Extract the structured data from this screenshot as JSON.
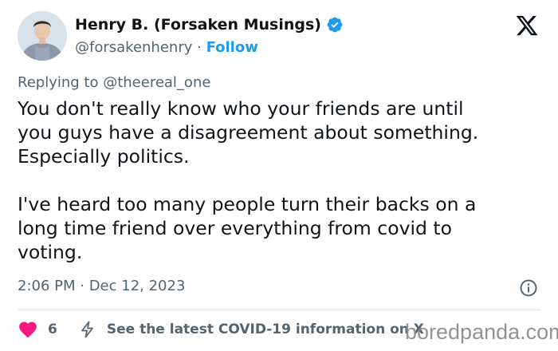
{
  "author": {
    "display_name": "Henry B. (Forsaken Musings)",
    "handle": "@forsakenhenry",
    "separator": "·",
    "follow_label": "Follow",
    "verified_color": "#1d9bf0"
  },
  "reply": {
    "prefix": "Replying to ",
    "mention": "@theereal_one"
  },
  "tweet": {
    "text": "You don't really know who your friends are until\nyou guys have a disagreement about something.\nEspecially politics.\n\nI've heard too many people turn their backs on a\nlong time friend over everything from covid to\nvoting.",
    "timestamp": "2:06 PM · Dec 12, 2023"
  },
  "footer": {
    "likes": "6",
    "covid_link": "See the latest COVID-19 information on X"
  },
  "watermark": {
    "text": "boredpanda.com"
  },
  "icons": {
    "logo": "x-logo-icon",
    "verified": "verified-badge-icon",
    "info": "info-icon",
    "like": "heart-icon",
    "covid": "lightning-bolt-icon"
  },
  "colors": {
    "accent": "#1d9bf0",
    "heart": "#f91880",
    "secondary_text": "#536471"
  }
}
